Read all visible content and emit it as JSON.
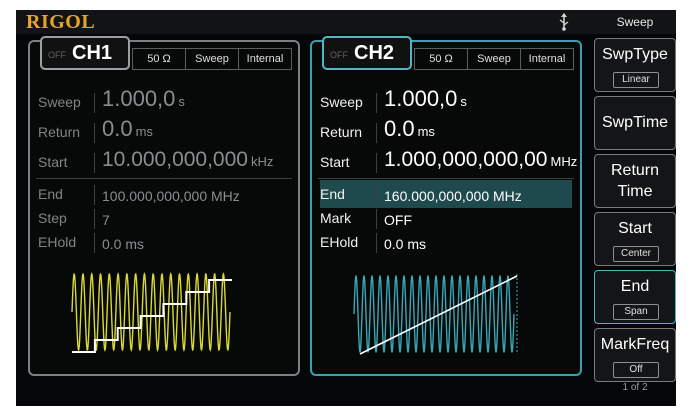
{
  "brand": "RIGOL",
  "menu_title": "Sweep",
  "ch1": {
    "name": "CH1",
    "status": "OFF",
    "impedance": "50 Ω",
    "mode": "Sweep",
    "source": "Internal",
    "rows": [
      {
        "label": "Sweep",
        "value": "1.000,0",
        "unit": "s"
      },
      {
        "label": "Return",
        "value": "0.0",
        "unit": "ms"
      },
      {
        "label": "Start",
        "value": "10.000,000,000",
        "unit": "kHz"
      },
      {
        "label": "End",
        "value": "100.000,000,000 MHz"
      },
      {
        "label": "Step",
        "value": "7"
      },
      {
        "label": "EHold",
        "value": "0.0 ms"
      }
    ]
  },
  "ch2": {
    "name": "CH2",
    "status": "OFF",
    "impedance": "50 Ω",
    "mode": "Sweep",
    "source": "Internal",
    "rows": [
      {
        "label": "Sweep",
        "value": "1.000,0",
        "unit": "s"
      },
      {
        "label": "Return",
        "value": "0.0",
        "unit": "ms"
      },
      {
        "label": "Start",
        "value": "1.000,000,000,00",
        "unit": "MHz"
      },
      {
        "label": "End",
        "value": "160.000,000,000 MHz"
      },
      {
        "label": "Mark",
        "value": "OFF"
      },
      {
        "label": "EHold",
        "value": "0.0 ms"
      }
    ]
  },
  "softkeys": [
    {
      "label": "SwpType",
      "sub": "Linear"
    },
    {
      "label": "SwpTime"
    },
    {
      "label": "Return Time"
    },
    {
      "label": "Start",
      "sub": "Center"
    },
    {
      "label": "End",
      "sub": "Span"
    },
    {
      "label": "MarkFreq",
      "sub": "Off"
    }
  ],
  "page_indicator": "1 of 2",
  "colors": {
    "accent": "#4fb7c5",
    "brand": "#e9a425",
    "ch1_wave": "#d9d936",
    "ch2_wave": "#3aa7b4"
  }
}
